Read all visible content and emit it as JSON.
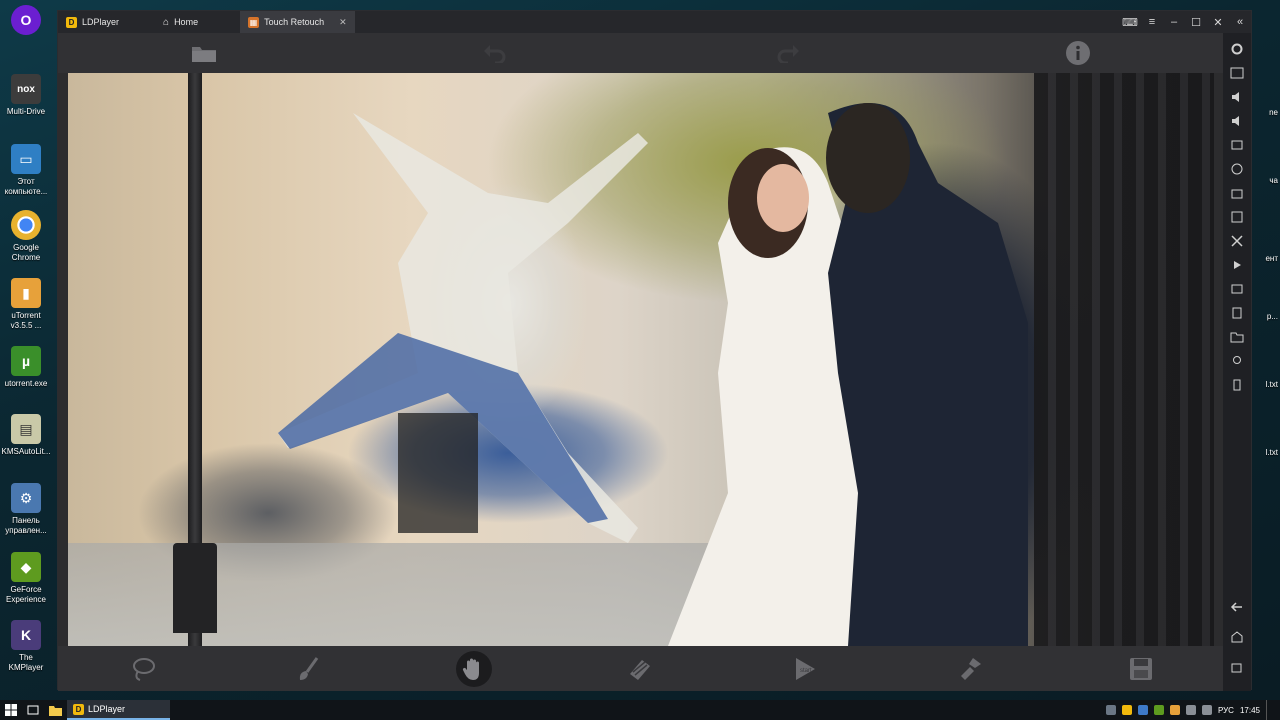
{
  "desktop": {
    "icons": [
      {
        "label": "",
        "name": "opera-gx",
        "color": "#6b1fd1",
        "glyph": "O"
      },
      {
        "label": "Multi-Drive",
        "name": "nox-multi-drive",
        "color": "#3c3c3c",
        "glyph": "nox"
      },
      {
        "label": "Этот\nкомпьюте...",
        "name": "this-pc",
        "color": "#2f7fc4",
        "glyph": "▭"
      },
      {
        "label": "Google\nChrome",
        "name": "google-chrome",
        "color": "#e8b22e",
        "glyph": "●"
      },
      {
        "label": "uTorrent\nv3.5.5 ...",
        "name": "utorrent-installer",
        "color": "#e7a13a",
        "glyph": "▮"
      },
      {
        "label": "utorrent.exe",
        "name": "utorrent-exe",
        "color": "#3a8f2a",
        "glyph": "µ"
      },
      {
        "label": "KMSAutoLit...",
        "name": "kmsautolite",
        "color": "#c9c9a8",
        "glyph": "▤"
      },
      {
        "label": "Панель\nуправлен...",
        "name": "control-panel",
        "color": "#4a78b0",
        "glyph": "⚙"
      },
      {
        "label": "GeForce\nExperience",
        "name": "geforce-experience",
        "color": "#5e9b1f",
        "glyph": "◆"
      },
      {
        "label": "The\nKMPlayer",
        "name": "kmplayer",
        "color": "#4a3c7a",
        "glyph": "K"
      }
    ],
    "right_labels": [
      "ne",
      "ча",
      "ент",
      "p...",
      "l.txt",
      "l.txt"
    ]
  },
  "window": {
    "tabs": [
      {
        "label": "LDPlayer",
        "name": "tab-ldplayer"
      },
      {
        "label": "Home",
        "name": "tab-home"
      },
      {
        "label": "Touch Retouch",
        "name": "tab-touch-retouch"
      }
    ]
  },
  "app": {
    "top_tools": [
      "open-folder-icon",
      "undo-icon",
      "redo-icon",
      "info-icon"
    ],
    "bottom_tools": [
      {
        "name": "lasso-tool",
        "icon": "lasso-icon"
      },
      {
        "name": "brush-tool",
        "icon": "brush-icon"
      },
      {
        "name": "pan-tool",
        "icon": "hand-icon",
        "active": true
      },
      {
        "name": "eraser-tool",
        "icon": "eraser-icon"
      },
      {
        "name": "start-tool",
        "icon": "play-start-icon"
      },
      {
        "name": "clone-stamp-tool",
        "icon": "stamp-icon"
      },
      {
        "name": "save-tool",
        "icon": "save-icon"
      }
    ]
  },
  "taskbar": {
    "app_label": "LDPlayer",
    "lang": "РУС",
    "time": "17:45"
  },
  "colors": {
    "accent": "#78b3e8",
    "toolbar": "#313134",
    "window": "#1b1c20"
  }
}
